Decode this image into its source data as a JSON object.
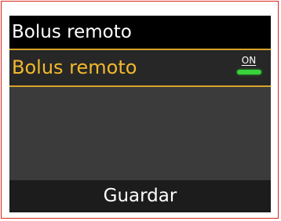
{
  "header": {
    "title": "Bolus remoto"
  },
  "setting": {
    "label": "Bolus remoto",
    "toggle_text": "ON",
    "toggle_state": "on",
    "toggle_color": "#37d43a"
  },
  "colors": {
    "accent": "#f2b92c",
    "frame": "#d9261c"
  },
  "softkey": {
    "label": "Guardar"
  }
}
